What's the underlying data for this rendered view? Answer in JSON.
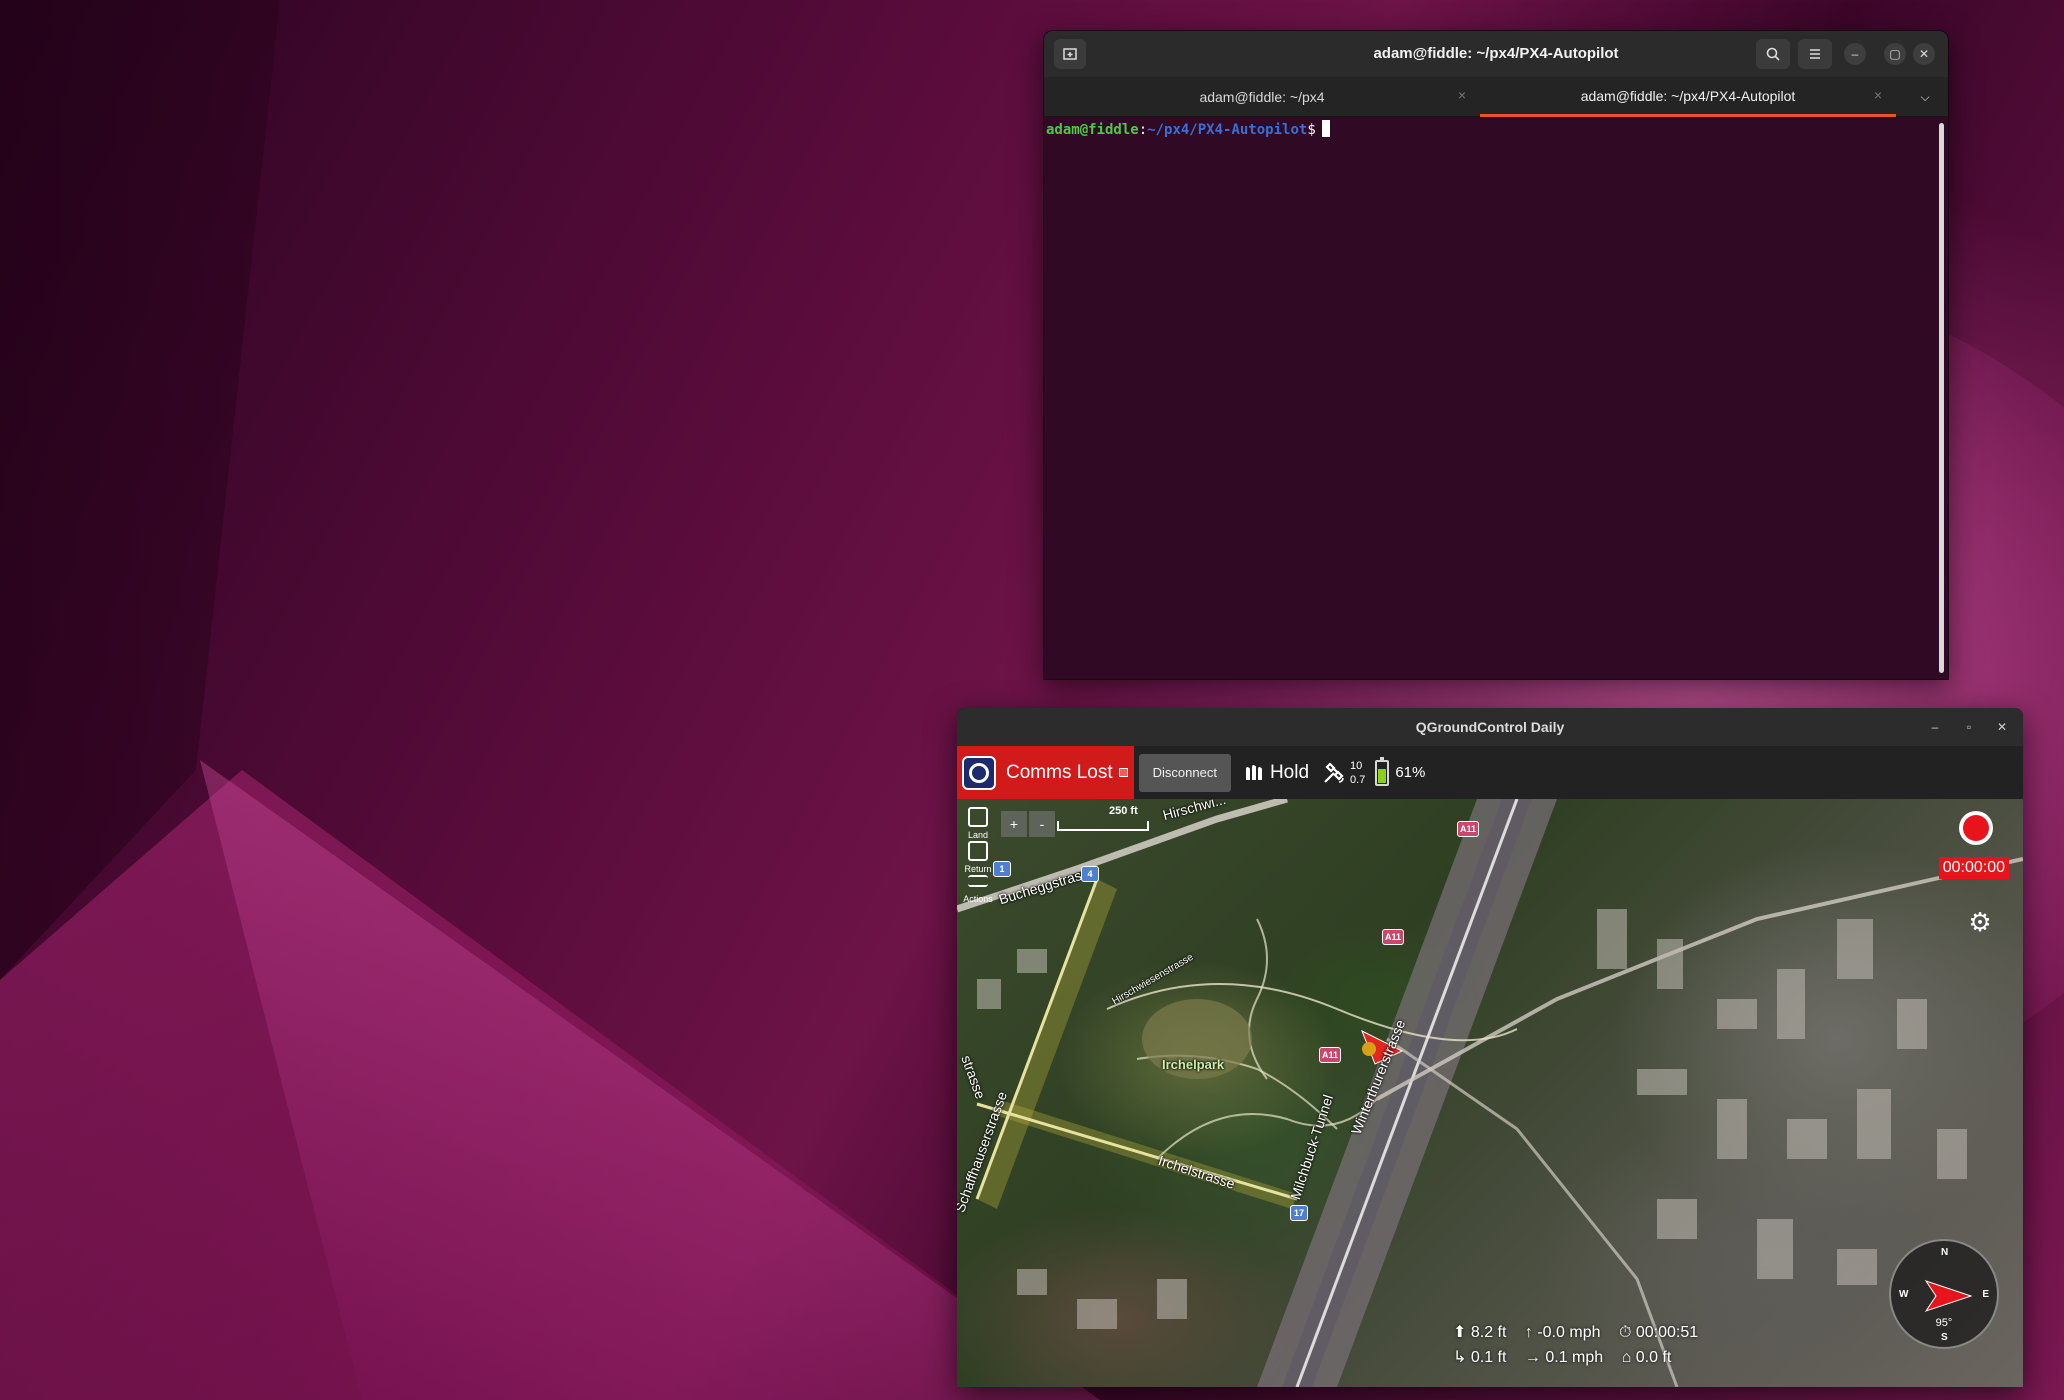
{
  "terminal": {
    "title": "adam@fiddle: ~/px4/PX4-Autopilot",
    "tabs": [
      {
        "label": "adam@fiddle: ~/px4",
        "active": false
      },
      {
        "label": "adam@fiddle: ~/px4/PX4-Autopilot",
        "active": true
      }
    ],
    "prompt_user": "adam@fiddle",
    "prompt_sep": ":",
    "prompt_path": "~/px4/PX4-Autopilot",
    "prompt_dollar": "$"
  },
  "qgc": {
    "title": "QGroundControl Daily",
    "status": "Comms Lost",
    "disconnect_label": "Disconnect",
    "flight_mode": "Hold",
    "gps_count": "10",
    "gps_hdop": "0.7",
    "battery": "61%",
    "battery_level": 0.61,
    "tools": {
      "land": "Land",
      "return": "Return",
      "actions": "Actions"
    },
    "zoom_in": "+",
    "zoom_out": "-",
    "scale": "250 ft",
    "record_time": "00:00:00",
    "map_labels": {
      "hirschwiesen": "Hirschwi...",
      "bucheggstrasse": "Bucheggstrasse",
      "hirschwiesenstrasse": "Hirschwiesenstrasse",
      "irchelpark": "Irchelpark",
      "winterthurerstrasse": "Winterthurerstrasse",
      "milchbuck": "Milchbuck-Tunnel",
      "schaffhauserstrasse": "Schaffhauserstrasse",
      "irchelstrasse": "Irchelstrasse",
      "strasse_left": "strasse"
    },
    "shields": {
      "a11": "A11",
      "r4": "4",
      "r1": "1",
      "r17": "17"
    },
    "telemetry": {
      "altitude": "8.2 ft",
      "vertical_speed": "-0.0 mph",
      "flight_time": "00:00:51",
      "distance": "0.1 ft",
      "horizontal_speed": "0.1 mph",
      "home_distance": "0.0 ft"
    },
    "compass": {
      "n": "N",
      "e": "E",
      "s": "S",
      "w": "W",
      "heading": "95°"
    }
  },
  "colors": {
    "accent": "#e95420",
    "comms_lost": "#d11a1a",
    "record": "#e8141c"
  }
}
